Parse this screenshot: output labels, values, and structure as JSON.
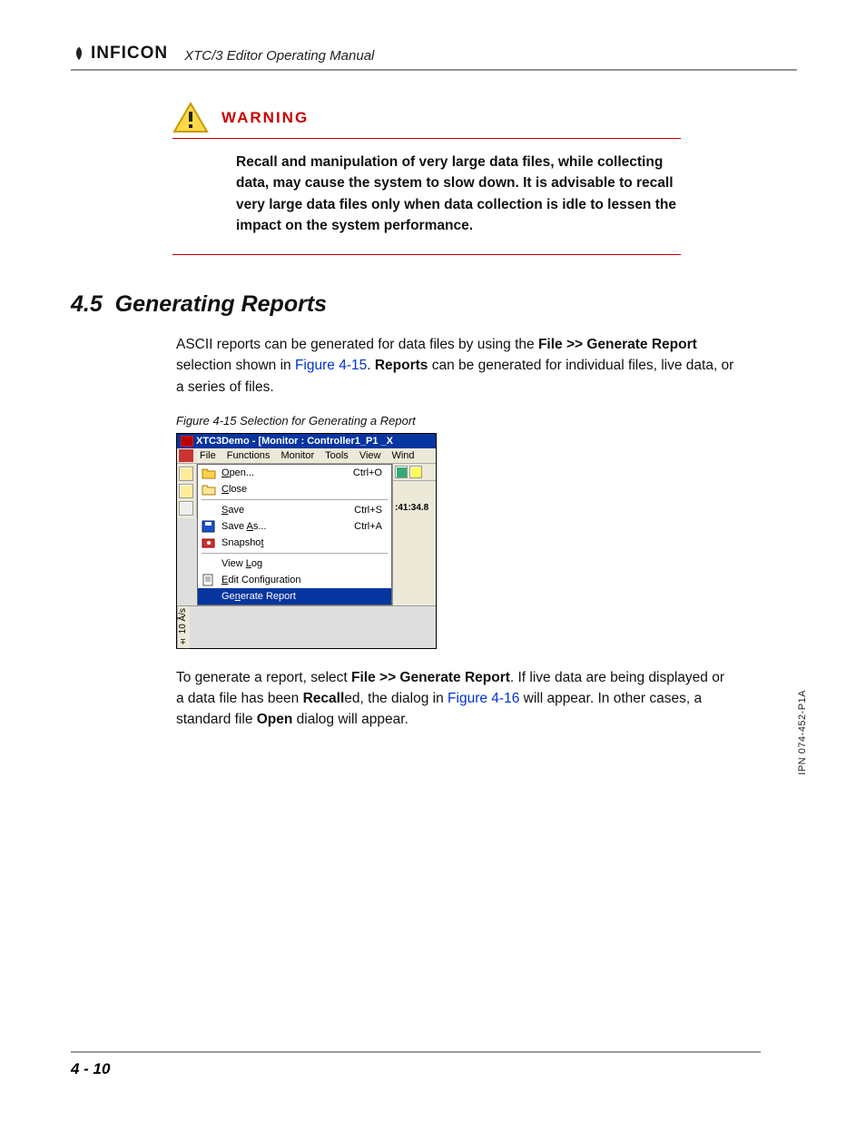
{
  "header": {
    "company": "INFICON",
    "manual_title": "XTC/3 Editor Operating Manual"
  },
  "warning": {
    "label": "WARNING",
    "body": "Recall and manipulation of very large data files, while collecting data, may cause the system to slow down. It is advisable to recall very large data files only when data collection is idle to lessen the impact on the system performance."
  },
  "section": {
    "number": "4.5",
    "title": "Generating Reports",
    "p1_a": "ASCII reports can be generated for data files by using the ",
    "p1_b": "File >> Generate Report",
    "p1_c": " selection shown in ",
    "p1_xref1": "Figure 4-15",
    "p1_d": ". ",
    "p1_e": "Reports",
    "p1_f": " can be generated for individual files, live data, or a series of files.",
    "fig_caption": "Figure 4-15  Selection for Generating a Report",
    "p2_a": "To generate a report, select ",
    "p2_b": "File >> Generate Report",
    "p2_c": ". If live data are being displayed or a data file has been ",
    "p2_d": "Recall",
    "p2_e": "ed, the dialog in ",
    "p2_xref2": "Figure 4-16",
    "p2_f": " will appear. In other cases, a standard file ",
    "p2_g": "Open",
    "p2_h": " dialog will appear."
  },
  "screenshot": {
    "title": "XTC3Demo - [Monitor : Controller1_P1 _X",
    "menus": {
      "file": "File",
      "functions": "Functions",
      "monitor": "Monitor",
      "tools": "Tools",
      "view": "View",
      "window": "Wind"
    },
    "items": {
      "open": "Open...",
      "open_sc": "Ctrl+O",
      "close": "Close",
      "save": "Save",
      "save_sc": "Ctrl+S",
      "saveas": "Save As...",
      "saveas_sc": "Ctrl+A",
      "snapshot": "Snapshot",
      "viewlog": "View Log",
      "editcfg": "Edit Configuration",
      "genrep": "Generate Report"
    },
    "axis": "± 10 Å/s",
    "time": ":41:34.8"
  },
  "footer": {
    "page": "4 - 10",
    "ipn": "IPN 074-452-P1A"
  }
}
